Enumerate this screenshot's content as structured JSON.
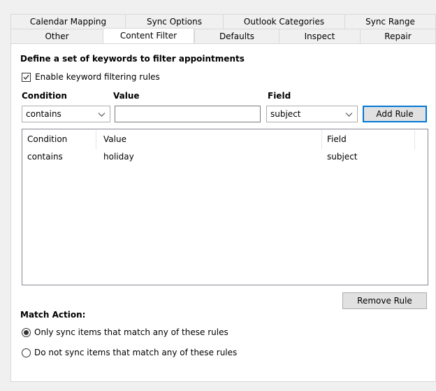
{
  "tabs_row1": [
    {
      "label": "Calendar Mapping"
    },
    {
      "label": "Sync Options"
    },
    {
      "label": "Outlook Categories"
    },
    {
      "label": "Sync Range"
    }
  ],
  "tabs_row2": [
    {
      "label": "Other"
    },
    {
      "label": "Content Filter",
      "active": true
    },
    {
      "label": "Defaults"
    },
    {
      "label": "Inspect"
    },
    {
      "label": "Repair"
    }
  ],
  "filter": {
    "heading": "Define a set of keywords to filter appointments",
    "enable_label": "Enable keyword filtering rules",
    "enable_checked": true,
    "condition_label": "Condition",
    "value_label": "Value",
    "field_label": "Field",
    "condition_value": "contains",
    "value_input": "",
    "field_value": "subject",
    "add_rule": "Add Rule"
  },
  "rules_table": {
    "headers": [
      "Condition",
      "Value",
      "Field"
    ],
    "rows": [
      [
        "contains",
        "holiday",
        "subject"
      ]
    ]
  },
  "remove_rule": "Remove Rule",
  "match_action": {
    "label": "Match Action:",
    "options": [
      {
        "label": "Only sync items that match any of these rules",
        "selected": true
      },
      {
        "label": "Do not sync items that match any of these rules",
        "selected": false
      }
    ]
  }
}
